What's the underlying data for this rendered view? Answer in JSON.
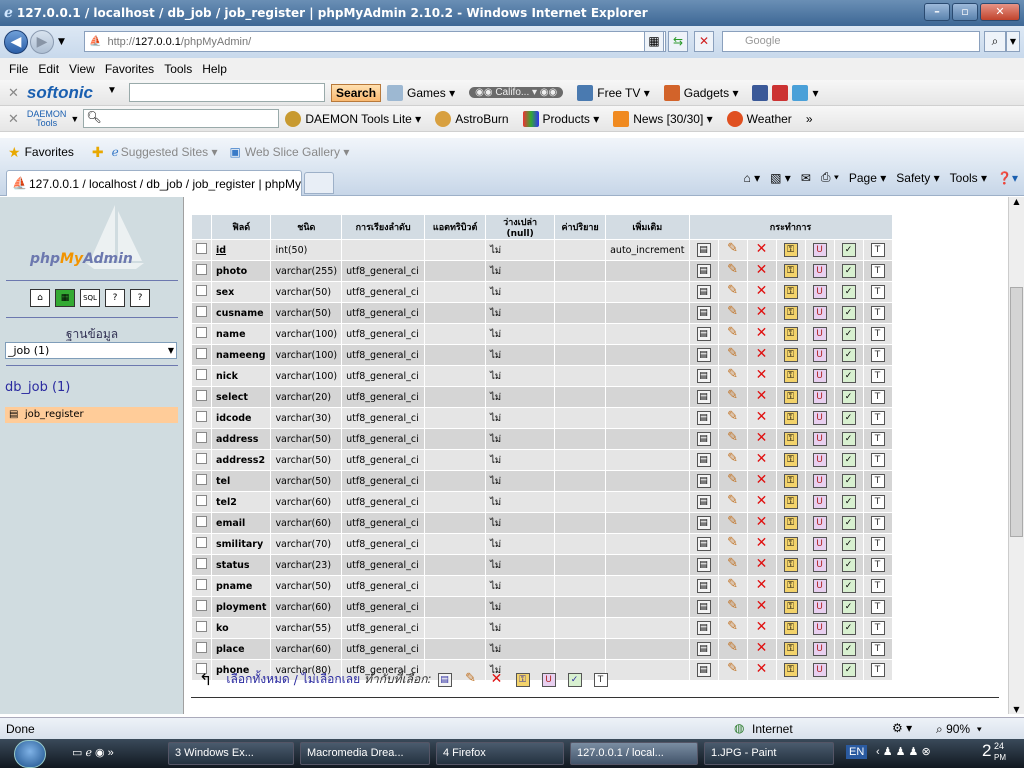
{
  "window": {
    "title": "127.0.0.1 / localhost / db_job / job_register | phpMyAdmin 2.10.2 - Windows Internet Explorer"
  },
  "address": {
    "url_prefix": "http://",
    "url_host": "127.0.0.1",
    "url_path": "/phpMyAdmin/",
    "search_placeholder": "Google"
  },
  "menu": [
    "File",
    "Edit",
    "View",
    "Favorites",
    "Tools",
    "Help"
  ],
  "softonic": {
    "brand": "softonic",
    "search_label": "Search",
    "items": [
      "Games",
      "Califo...",
      "Free TV",
      "Gadgets"
    ]
  },
  "daemon": {
    "brand_top": "DAEMON",
    "brand_bottom": "Tools",
    "items": [
      "DAEMON Tools Lite",
      "AstroBurn",
      "Products",
      "News [30/30]",
      "Weather"
    ]
  },
  "favorites": {
    "label": "Favorites",
    "items": [
      "Suggested Sites",
      "Web Slice Gallery"
    ]
  },
  "tab": {
    "title": "127.0.0.1 / localhost / db_job / job_register | phpMy..."
  },
  "command_bar": [
    "Page",
    "Safety",
    "Tools"
  ],
  "sidebar": {
    "logo_php": "php",
    "logo_my": "My",
    "logo_admin": "Admin",
    "database_label": "ฐานข้อมูล",
    "database_select": "_job (1)",
    "db_name": "db_job (1)",
    "table_name": "job_register"
  },
  "structure": {
    "headers": [
      "ฟิลด์",
      "ชนิด",
      "การเรียงลำดับ",
      "แอตทริบิวต์",
      "ว่างเปล่า (null)",
      "ค่าปริยาย",
      "เพิ่มเติม",
      "กระทำการ"
    ],
    "rows": [
      {
        "field": "id",
        "type": "int(50)",
        "collation": "",
        "null": "ไม่",
        "extra": "auto_increment"
      },
      {
        "field": "photo",
        "type": "varchar(255)",
        "collation": "utf8_general_ci",
        "null": "ไม่",
        "extra": ""
      },
      {
        "field": "sex",
        "type": "varchar(50)",
        "collation": "utf8_general_ci",
        "null": "ไม่",
        "extra": ""
      },
      {
        "field": "cusname",
        "type": "varchar(50)",
        "collation": "utf8_general_ci",
        "null": "ไม่",
        "extra": ""
      },
      {
        "field": "name",
        "type": "varchar(100)",
        "collation": "utf8_general_ci",
        "null": "ไม่",
        "extra": ""
      },
      {
        "field": "nameeng",
        "type": "varchar(100)",
        "collation": "utf8_general_ci",
        "null": "ไม่",
        "extra": ""
      },
      {
        "field": "nick",
        "type": "varchar(100)",
        "collation": "utf8_general_ci",
        "null": "ไม่",
        "extra": ""
      },
      {
        "field": "select",
        "type": "varchar(20)",
        "collation": "utf8_general_ci",
        "null": "ไม่",
        "extra": ""
      },
      {
        "field": "idcode",
        "type": "varchar(30)",
        "collation": "utf8_general_ci",
        "null": "ไม่",
        "extra": ""
      },
      {
        "field": "address",
        "type": "varchar(50)",
        "collation": "utf8_general_ci",
        "null": "ไม่",
        "extra": ""
      },
      {
        "field": "address2",
        "type": "varchar(50)",
        "collation": "utf8_general_ci",
        "null": "ไม่",
        "extra": ""
      },
      {
        "field": "tel",
        "type": "varchar(50)",
        "collation": "utf8_general_ci",
        "null": "ไม่",
        "extra": ""
      },
      {
        "field": "tel2",
        "type": "varchar(60)",
        "collation": "utf8_general_ci",
        "null": "ไม่",
        "extra": ""
      },
      {
        "field": "email",
        "type": "varchar(60)",
        "collation": "utf8_general_ci",
        "null": "ไม่",
        "extra": ""
      },
      {
        "field": "smilitary",
        "type": "varchar(70)",
        "collation": "utf8_general_ci",
        "null": "ไม่",
        "extra": ""
      },
      {
        "field": "status",
        "type": "varchar(23)",
        "collation": "utf8_general_ci",
        "null": "ไม่",
        "extra": ""
      },
      {
        "field": "pname",
        "type": "varchar(50)",
        "collation": "utf8_general_ci",
        "null": "ไม่",
        "extra": ""
      },
      {
        "field": "ployment",
        "type": "varchar(60)",
        "collation": "utf8_general_ci",
        "null": "ไม่",
        "extra": ""
      },
      {
        "field": "ko",
        "type": "varchar(55)",
        "collation": "utf8_general_ci",
        "null": "ไม่",
        "extra": ""
      },
      {
        "field": "place",
        "type": "varchar(60)",
        "collation": "utf8_general_ci",
        "null": "ไม่",
        "extra": ""
      },
      {
        "field": "phone",
        "type": "varchar(80)",
        "collation": "utf8_general_ci",
        "null": "ไม่",
        "extra": ""
      }
    ]
  },
  "bulk": {
    "check_all": "เลือกทั้งหมด",
    "separator": "/",
    "uncheck_all": "ไม่เลือกเลย",
    "with_selected": "ทำกับที่เลือก:"
  },
  "status": {
    "left": "Done",
    "zone": "Internet",
    "zoom": "90%"
  },
  "taskbar": {
    "tasks": [
      "3 Windows Ex...",
      "Macromedia Drea...",
      "4 Firefox",
      "127.0.0.1 / local...",
      "1.JPG - Paint"
    ],
    "lang": "EN",
    "clock_time": "24",
    "clock_suffix": "PM",
    "clock_hour": "2"
  },
  "colors": {
    "header_bg": "#d3dce3",
    "row_odd": "#e5e5e5",
    "row_even": "#d5d5d5",
    "selected_table": "#ffcc99",
    "sidebar_bg": "#d0dce0"
  }
}
